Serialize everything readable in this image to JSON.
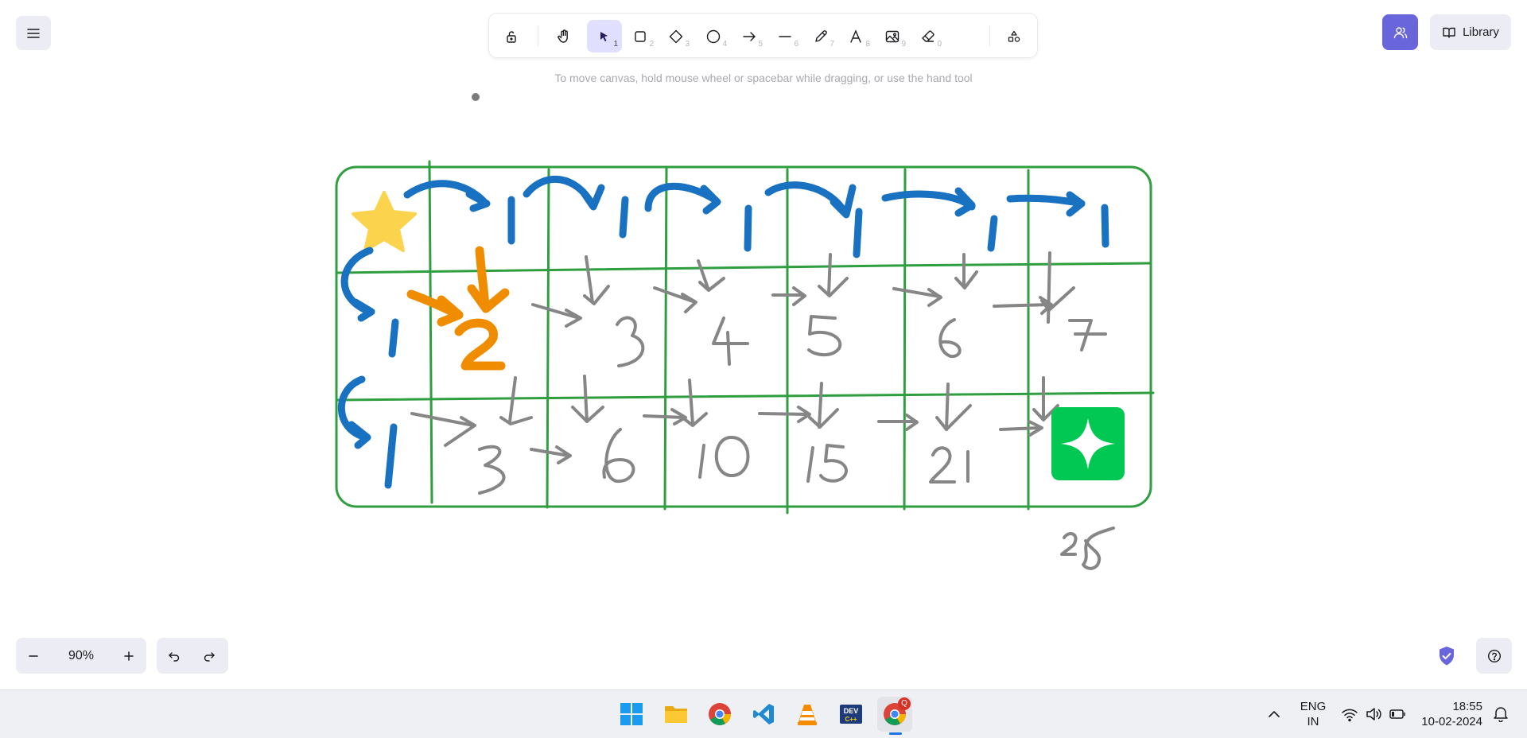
{
  "toolbar": {
    "tools": [
      {
        "name": "lock",
        "key": ""
      },
      {
        "name": "hand",
        "key": ""
      },
      {
        "name": "selection",
        "key": "1",
        "active": true
      },
      {
        "name": "rectangle",
        "key": "2"
      },
      {
        "name": "diamond",
        "key": "3"
      },
      {
        "name": "ellipse",
        "key": "4"
      },
      {
        "name": "arrow",
        "key": "5"
      },
      {
        "name": "line",
        "key": "6"
      },
      {
        "name": "draw",
        "key": "7"
      },
      {
        "name": "text",
        "key": "8"
      },
      {
        "name": "image",
        "key": "9"
      },
      {
        "name": "eraser",
        "key": "0"
      },
      {
        "name": "extra-tools",
        "key": ""
      }
    ],
    "hint": "To move canvas, hold mouse wheel or spacebar while dragging, or use the hand tool"
  },
  "header": {
    "library_label": "Library"
  },
  "footer": {
    "zoom_level": "90%"
  },
  "canvas": {
    "grid_color": "#2e9e3f",
    "blue_color": "#1971c2",
    "orange_color": "#f08c00",
    "gray_color": "#868686",
    "row1": [
      "1",
      "1",
      "1",
      "1",
      "1",
      "1"
    ],
    "row2": [
      "1",
      "2",
      "3",
      "4",
      "5",
      "6",
      "7"
    ],
    "row3": [
      "1",
      "3",
      "6",
      "10",
      "15",
      "21"
    ],
    "result": "28"
  },
  "taskbar": {
    "language_top": "ENG",
    "language_bottom": "IN",
    "time": "18:55",
    "date": "10-02-2024",
    "chrome_badge": "Q"
  },
  "colors": {
    "accent": "#6965db",
    "accent_light": "#e0dfff",
    "button_bg": "#ececf4"
  }
}
